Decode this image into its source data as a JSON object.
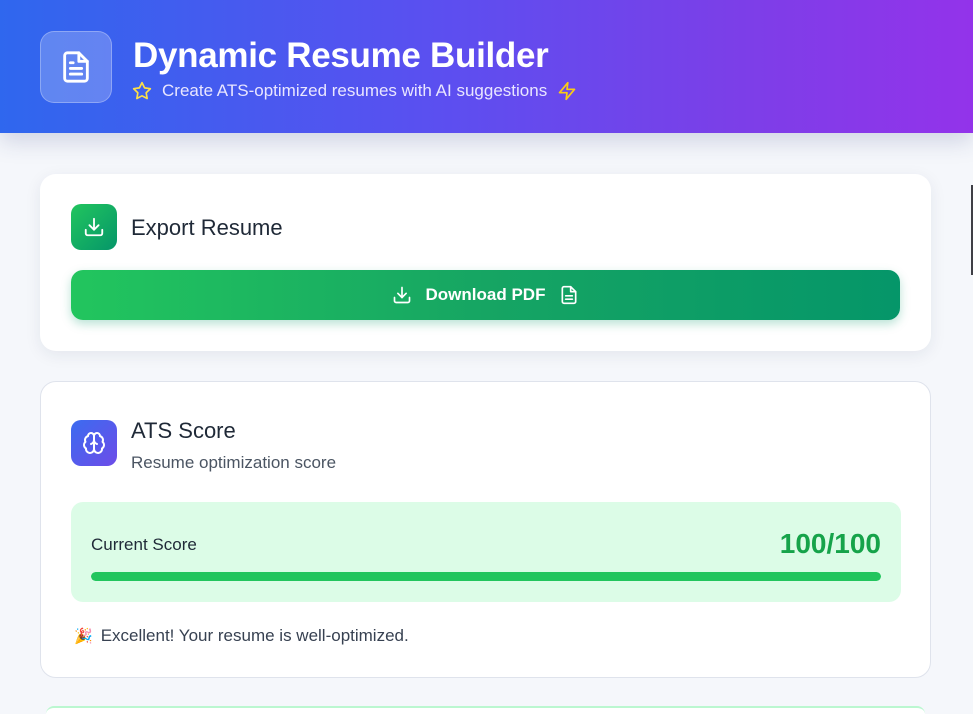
{
  "header": {
    "title": "Dynamic Resume Builder",
    "subtitle": "Create ATS-optimized resumes with AI suggestions",
    "logo_icon": "document-icon",
    "leading_icon": "star-icon",
    "trailing_icon": "lightning-icon"
  },
  "export_card": {
    "title": "Export Resume",
    "icon": "download-icon",
    "download_button": {
      "label": "Download PDF",
      "leading_icon": "download-icon",
      "trailing_icon": "file-icon"
    }
  },
  "ats_card": {
    "title": "ATS Score",
    "subtitle": "Resume optimization score",
    "icon": "brain-icon",
    "score": {
      "label": "Current Score",
      "value_text": "100/100",
      "value": 100,
      "max": 100
    },
    "feedback": {
      "emoji": "🎉",
      "text": "Excellent! Your resume is well-optimized."
    }
  },
  "colors": {
    "header_gradient_start": "#2f67ee",
    "header_gradient_end": "#9333ea",
    "accent_green": "#22c55e",
    "score_green": "#16a34a",
    "score_panel_bg": "#dcfce7",
    "star_yellow": "#fde047",
    "lightning_yellow": "#facc15"
  }
}
